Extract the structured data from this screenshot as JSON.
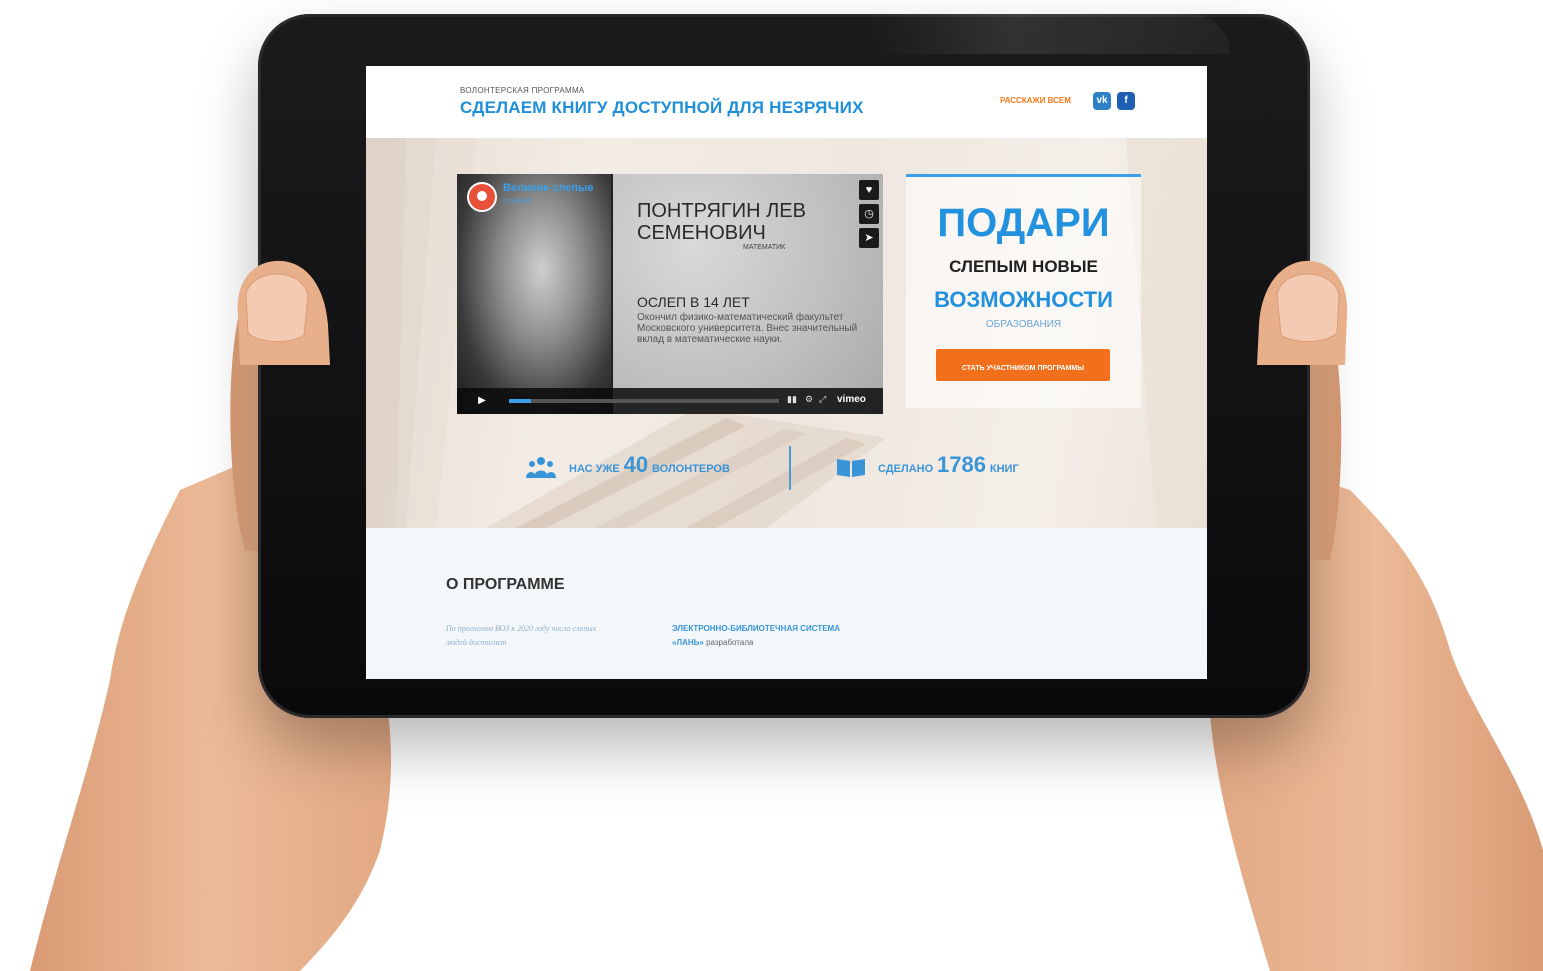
{
  "header": {
    "program_label": "ВОЛОНТЕРСКАЯ ПРОГРАММА",
    "title": "СДЕЛАЕМ КНИГУ ДОСТУПНОЙ ДЛЯ НЕЗРЯЧИХ",
    "share_label": "РАССКАЖИ ВСЕМ",
    "social": {
      "vk": "vk",
      "fb": "f"
    }
  },
  "video": {
    "channel_name": "Великие слепые",
    "channel_by": "от",
    "channel_source": "vimeo",
    "person_name": "ПОНТРЯГИН ЛЕВ СЕМЕНОВИЧ",
    "person_field": "МАТЕМАТИК",
    "blind_age": "ОСЛЕП В 14 ЛЕТ",
    "bio": "Окончил физико-математический факультет Московского университета. Внес значительный вклад в математические науки.",
    "actions": [
      "heart-icon",
      "clock-icon",
      "send-icon"
    ],
    "play_glyph": "▶",
    "vimeo_label": "vimeo",
    "progress": 0.08
  },
  "donate": {
    "title": "ПОДАРИ",
    "line1": "СЛЕПЫМ НОВЫЕ",
    "line2": "ВОЗМОЖНОСТИ",
    "line3": "ОБРАЗОВАНИЯ",
    "button": "СТАТЬ УЧАСТНИКОМ ПРОГРАММЫ"
  },
  "stats": {
    "volunteers_prefix": "НАС УЖЕ",
    "volunteers_count": "40",
    "volunteers_suffix": "ВОЛОНТЕРОВ",
    "books_prefix": "СДЕЛАНО",
    "books_count": "1786",
    "books_suffix": "КНИГ"
  },
  "about": {
    "title": "О ПРОГРАММЕ",
    "left_text": "По прогнозам ВОЗ к 2020 году число слепых людей достигнет",
    "right_highlight": "ЭЛЕКТРОННО-БИБЛИОТЕЧНАЯ СИСТЕМА «ЛАНЬ»",
    "right_text": "разработала"
  },
  "colors": {
    "accent_blue": "#2291de",
    "accent_orange": "#f26f1c",
    "tablet_black": "#0a0a0b",
    "skin": "#e9b28c"
  }
}
